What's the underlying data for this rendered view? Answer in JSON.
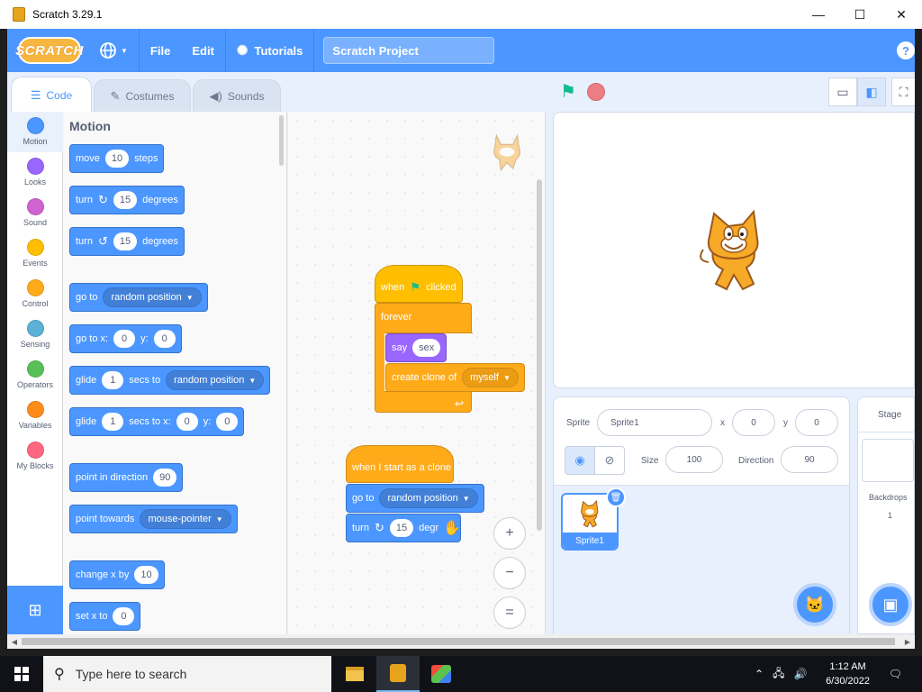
{
  "window": {
    "title": "Scratch 3.29.1",
    "controls": [
      "—",
      "☐",
      "✕"
    ]
  },
  "menubar": {
    "logo": "SCRATCH",
    "language_icon": "globe-icon",
    "file": "File",
    "edit": "Edit",
    "tutorials": "Tutorials",
    "project_title": "Scratch Project",
    "help": "?"
  },
  "tabs": [
    {
      "label": "Code",
      "icon": "code-icon"
    },
    {
      "label": "Costumes",
      "icon": "brush-icon"
    },
    {
      "label": "Sounds",
      "icon": "speaker-icon"
    }
  ],
  "categories": [
    {
      "label": "Motion",
      "color": "#4c97ff"
    },
    {
      "label": "Looks",
      "color": "#9966ff"
    },
    {
      "label": "Sound",
      "color": "#cf63cf"
    },
    {
      "label": "Events",
      "color": "#ffbf00"
    },
    {
      "label": "Control",
      "color": "#ffab19"
    },
    {
      "label": "Sensing",
      "color": "#5cb1d6"
    },
    {
      "label": "Operators",
      "color": "#59c059"
    },
    {
      "label": "Variables",
      "color": "#ff8c1a"
    },
    {
      "label": "My Blocks",
      "color": "#ff6680"
    }
  ],
  "palette": {
    "heading": "Motion",
    "move": {
      "a": "move",
      "v": "10",
      "b": "steps"
    },
    "turn_cw": {
      "a": "turn",
      "v": "15",
      "b": "degrees"
    },
    "turn_ccw": {
      "a": "turn",
      "v": "15",
      "b": "degrees"
    },
    "goto": {
      "a": "go to",
      "dd": "random position"
    },
    "gotoxy": {
      "a": "go to x:",
      "x": "0",
      "yl": "y:",
      "y": "0"
    },
    "glide_to": {
      "a": "glide",
      "v": "1",
      "b": "secs to",
      "dd": "random position"
    },
    "glide_xy": {
      "a": "glide",
      "v": "1",
      "b": "secs to x:",
      "x": "0",
      "yl": "y:",
      "y": "0"
    },
    "point_dir": {
      "a": "point in direction",
      "v": "90"
    },
    "point_towards": {
      "a": "point towards",
      "dd": "mouse-pointer"
    },
    "change_x": {
      "a": "change x by",
      "v": "10"
    },
    "set_x": {
      "a": "set x to",
      "v": "0"
    }
  },
  "script": {
    "s1": {
      "hat_a": "when",
      "hat_b": "clicked",
      "forever": "forever",
      "say": "say",
      "say_val": "sex",
      "clone_a": "create clone of",
      "clone_dd": "myself"
    },
    "s2": {
      "hat": "when I start as a clone",
      "goto": "go to",
      "goto_dd": "random position",
      "turn": "turn",
      "turn_val": "15",
      "turn_b": "degr"
    },
    "zoom_in": "+",
    "zoom_out": "−",
    "zoom_reset": "="
  },
  "sprite_info": {
    "sprite_label": "Sprite",
    "sprite_name": "Sprite1",
    "x_label": "x",
    "x_val": "0",
    "y_label": "y",
    "y_val": "0",
    "show_label": "Show",
    "size_label": "Size",
    "size_val": "100",
    "direction_label": "Direction",
    "direction_val": "90"
  },
  "sprites": [
    {
      "name": "Sprite1"
    }
  ],
  "stage_target": {
    "label": "Stage",
    "backdrops_label": "Backdrops",
    "backdrops_count": "1"
  },
  "taskbar": {
    "search_placeholder": "Type here to search",
    "time": "1:12 AM",
    "date": "6/30/2022"
  }
}
